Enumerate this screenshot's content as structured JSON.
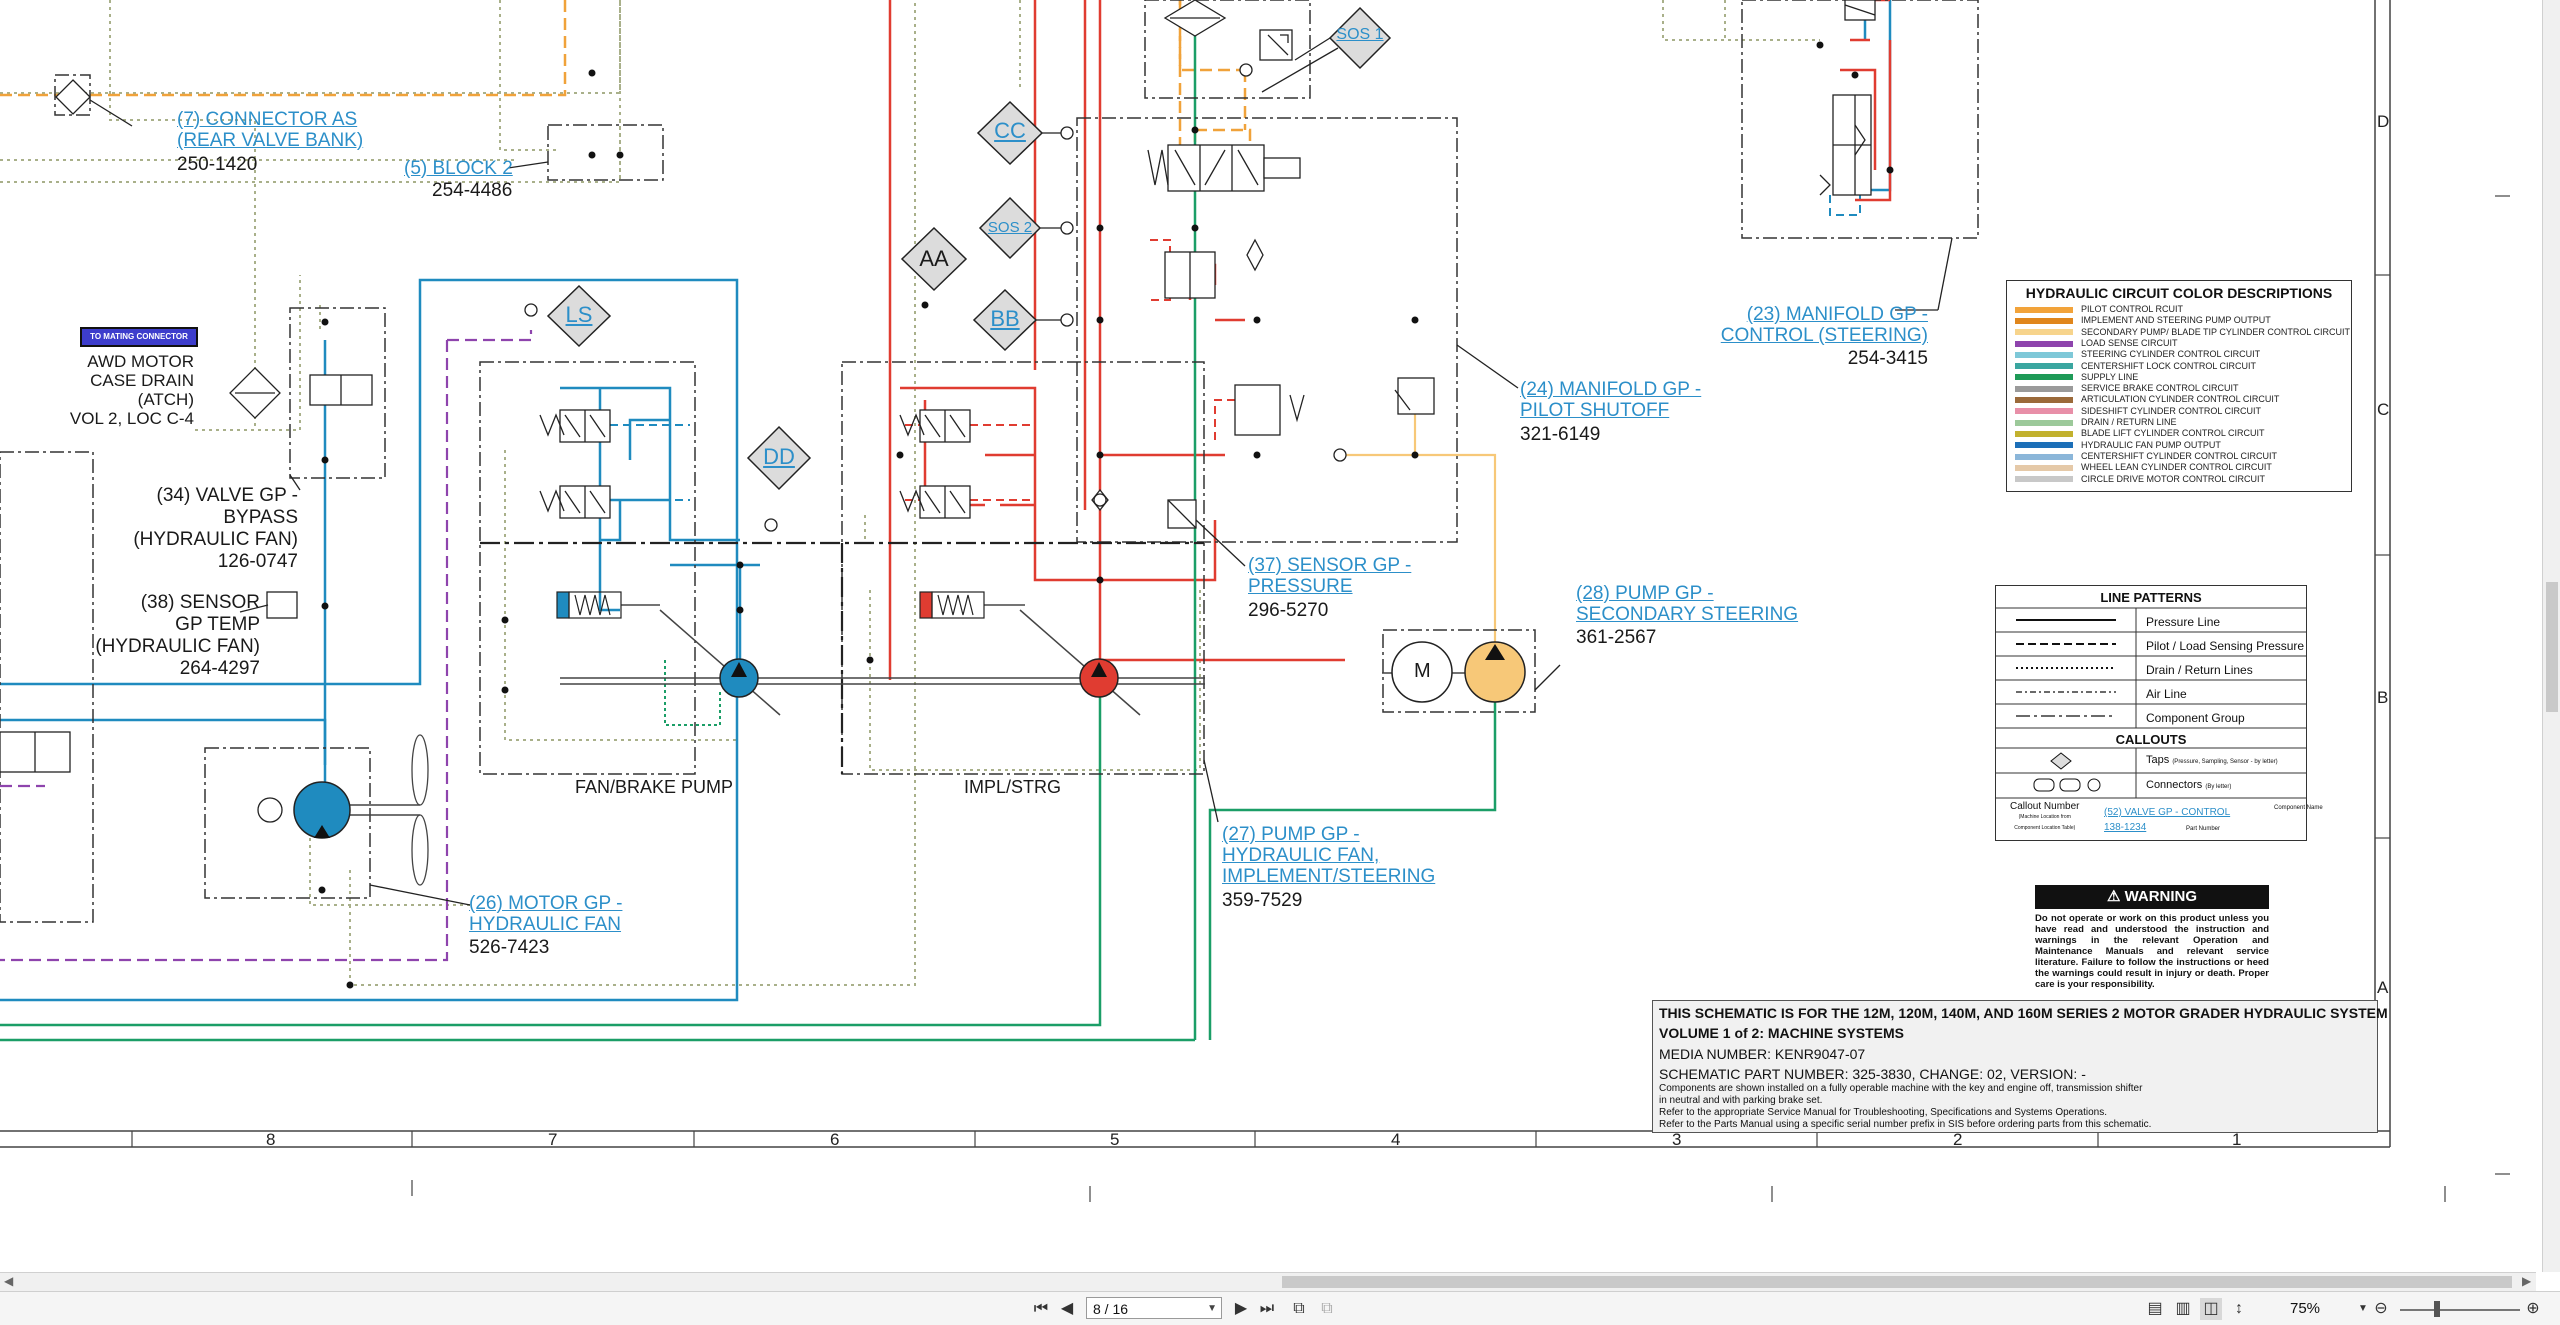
{
  "schematic": {
    "components": [
      {
        "id": "c7",
        "num_name": "(7) CONNECTOR AS",
        "name2": "(REAR VALVE BANK)",
        "part": "250-1420"
      },
      {
        "id": "c5",
        "num_name": "(5) BLOCK 2",
        "part": "254-4486"
      },
      {
        "id": "c34",
        "line1": "(34) VALVE GP -",
        "line2": "BYPASS",
        "line3": "(HYDRAULIC FAN)",
        "part": "126-0747"
      },
      {
        "id": "c38",
        "line1": "(38) SENSOR",
        "line2": "GP TEMP",
        "line3": "(HYDRAULIC FAN)",
        "part": "264-4297"
      },
      {
        "id": "c26",
        "line1": "(26) MOTOR GP -",
        "line2": "HYDRAULIC FAN",
        "part": "526-7423"
      },
      {
        "id": "c37",
        "line1": "(37) SENSOR GP -",
        "line2": "PRESSURE",
        "part": "296-5270"
      },
      {
        "id": "c27",
        "line1": "(27) PUMP GP -",
        "line2": "HYDRAULIC FAN,",
        "line3": "IMPLEMENT/STEERING",
        "part": "359-7529"
      },
      {
        "id": "c28",
        "line1": "(28) PUMP GP -",
        "line2": "SECONDARY STEERING",
        "part": "361-2567"
      },
      {
        "id": "c24",
        "line1": "(24) MANIFOLD GP -",
        "line2": "PILOT SHUTOFF",
        "part": "321-6149"
      },
      {
        "id": "c23",
        "line1": "(23) MANIFOLD GP -",
        "line2": "CONTROL (STEERING)",
        "part": "254-3415"
      }
    ],
    "awd": {
      "line1": "AWD MOTOR",
      "line2": "CASE DRAIN",
      "line3": "(ATCH)",
      "line4": "VOL 2, LOC C-4",
      "mating": "TO MATING CONNECTOR"
    },
    "callouts": {
      "sos1": "SOS 1",
      "cc": "CC",
      "sos2": "SOS 2",
      "aa": "AA",
      "bb": "BB",
      "ls": "LS",
      "dd": "DD"
    },
    "section_labels": {
      "fan_brake": "FAN/BRAKE PUMP",
      "impl_strg": "IMPL/STRG",
      "motor": "M"
    },
    "grid_columns": [
      "8",
      "7",
      "6",
      "5",
      "4",
      "3",
      "2",
      "1"
    ],
    "grid_rows": [
      "D",
      "C",
      "B",
      "A"
    ]
  },
  "color_legend": {
    "title": "HYDRAULIC CIRCUIT COLOR DESCRIPTIONS",
    "items": [
      {
        "color": "#f2a33a",
        "label": "PILOT CONTROL RCUIT"
      },
      {
        "color": "#e0861c",
        "label": "IMPLEMENT AND STEERING PUMP OUTPUT"
      },
      {
        "color": "#f7d48c",
        "label": "SECONDARY PUMP/ BLADE TIP CYLINDER CONTROL CIRCUIT"
      },
      {
        "color": "#8e44ad",
        "label": "LOAD SENSE CIRCUIT"
      },
      {
        "color": "#7ec8d8",
        "label": "STEERING CYLINDER CONTROL CIRCUIT"
      },
      {
        "color": "#3aa6a0",
        "label": "CENTERSHIFT LOCK CONTROL CIRCUIT"
      },
      {
        "color": "#1e9a57",
        "label": "SUPPLY LINE"
      },
      {
        "color": "#9a9a9a",
        "label": "SERVICE BRAKE CONTROL CIRCUIT"
      },
      {
        "color": "#9b6a3a",
        "label": "ARTICULATION CYLINDER CONTROL CIRCUIT"
      },
      {
        "color": "#e88fa8",
        "label": "SIDESHIFT CYLINDER CONTROL CIRCUIT"
      },
      {
        "color": "#9cc99a",
        "label": "DRAIN / RETURN LINE"
      },
      {
        "color": "#c2b12e",
        "label": "BLADE LIFT CYLINDER CONTROL CIRCUIT"
      },
      {
        "color": "#1c6fb8",
        "label": "HYDRAULIC FAN PUMP OUTPUT"
      },
      {
        "color": "#8bb6d9",
        "label": "CENTERSHIFT CYLINDER CONTROL CIRCUIT"
      },
      {
        "color": "#e5c9a8",
        "label": "WHEEL LEAN CYLINDER CONTROL CIRCUIT"
      },
      {
        "color": "#c8c8c8",
        "label": "CIRCLE DRIVE MOTOR CONTROL CIRCUIT"
      }
    ]
  },
  "line_patterns": {
    "title": "LINE PATTERNS",
    "items": [
      "Pressure Line",
      "Pilot / Load Sensing Pressure",
      "Drain / Return Lines",
      "Air Line",
      "Component Group"
    ],
    "callouts_title": "CALLOUTS",
    "taps": "Taps",
    "taps_note": "(Pressure, Sampling, Sensor - by letter)",
    "connectors": "Connectors",
    "connectors_note": "(By letter)",
    "callout_number": "Callout Number",
    "callout_number_note1": "(Machine Location from",
    "callout_number_note2": "Component Location Table)",
    "example_link": "(52) VALVE GP - CONTROL",
    "example_part": "138-1234",
    "component_name": "Component Name",
    "part_number": "Part Number"
  },
  "warning": {
    "title": "WARNING",
    "text": "Do not operate or work on this product unless you have read and understood the instruction and warnings in the relevant Operation and Maintenance Manuals and relevant service literature. Failure to follow the instructions or heed the warnings could result in injury or death. Proper care is your responsibility."
  },
  "title_block": {
    "line1": "THIS SCHEMATIC IS FOR THE 12M, 120M, 140M, AND 160M SERIES 2 MOTOR GRADER HYDRAULIC SYSTEM",
    "line2": "VOLUME 1 of 2: MACHINE SYSTEMS",
    "line3": "MEDIA NUMBER: KENR9047-07",
    "line4": "SCHEMATIC PART NUMBER: 325-3830, CHANGE: 02, VERSION: -",
    "line5": "Components are shown installed on a fully operable machine with the key and engine off, transmission shifter",
    "line6": "in neutral and with parking brake set.",
    "line7": "Refer to the appropriate Service Manual for Troubleshooting, Specifications and Systems Operations.",
    "line8": "Refer to the Parts Manual using a specific serial number prefix in SIS before ordering parts from this schematic."
  },
  "viewer": {
    "page_field": "8 / 16",
    "zoom": "75%",
    "colors": {
      "fan": "#1f8bbf",
      "red": "#e03c31",
      "green": "#1b9e67",
      "orange": "#f0a23a",
      "purple": "#8e44ad",
      "drain": "#a9b08a"
    }
  }
}
